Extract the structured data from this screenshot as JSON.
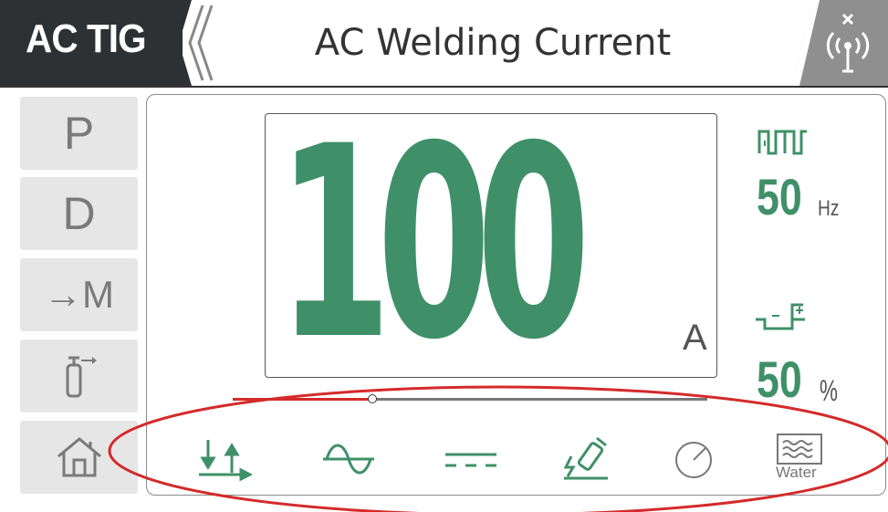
{
  "header": {
    "mode": "AC TIG",
    "title": "AC Welding Current",
    "signal_icon": "wireless-off-icon"
  },
  "sidebar": {
    "items": [
      {
        "label": "P",
        "name": "program"
      },
      {
        "label": "D",
        "name": "display"
      },
      {
        "label": "→M",
        "name": "memory"
      },
      {
        "label": "",
        "icon": "gas-cylinder-icon"
      },
      {
        "label": "",
        "icon": "home-icon"
      }
    ]
  },
  "main": {
    "current_value": "100",
    "current_unit": "A",
    "frequency": {
      "icon": "ac-frequency-icon",
      "value": "50",
      "unit": "Hz"
    },
    "balance": {
      "icon": "ac-balance-icon",
      "value": "50",
      "unit": "%"
    }
  },
  "bottom_bar": {
    "items": [
      {
        "icon": "arc-start-mode-icon"
      },
      {
        "icon": "ac-waveform-icon"
      },
      {
        "icon": "dc-mode-icon"
      },
      {
        "icon": "torch-icon"
      },
      {
        "icon": "gauge-icon"
      },
      {
        "label": "Water",
        "icon": "water-cooling-icon"
      }
    ]
  },
  "colors": {
    "accent_green": "#3f9068",
    "header_dark": "#2e3133",
    "annotation_red": "#d42a2a"
  }
}
